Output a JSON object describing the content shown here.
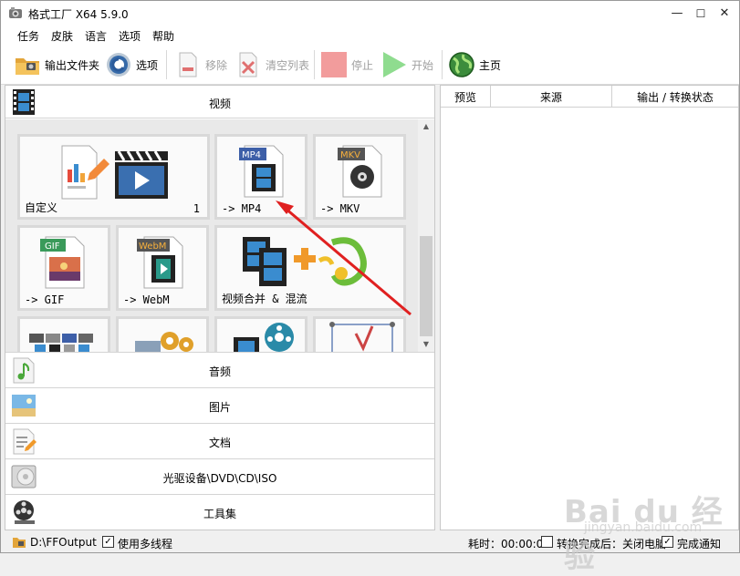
{
  "window": {
    "title": "格式工厂 X64 5.9.0",
    "minimize": "—",
    "maximize": "☐",
    "close": "✕"
  },
  "menu": [
    "任务",
    "皮肤",
    "语言",
    "选项",
    "帮助"
  ],
  "toolbar": {
    "output_folder": "输出文件夹",
    "options": "选项",
    "remove": "移除",
    "clear_list": "清空列表",
    "stop": "停止",
    "start": "开始",
    "home": "主页"
  },
  "left": {
    "video_header": "视频",
    "tiles": [
      {
        "label": "自定义",
        "count": "1"
      },
      {
        "label": "-> MP4",
        "badge": "MP4"
      },
      {
        "label": "-> MKV",
        "badge": "MKV"
      },
      {
        "label": "-> GIF",
        "badge": "GIF"
      },
      {
        "label": "-> WebM",
        "badge": "WebM"
      },
      {
        "label": "视频合并 & 混流"
      }
    ],
    "categories": [
      "音频",
      "图片",
      "文档",
      "光驱设备\\DVD\\CD\\ISO",
      "工具集"
    ]
  },
  "right": {
    "columns": [
      "预览",
      "来源",
      "输出 / 转换状态"
    ]
  },
  "status": {
    "output_path": "D:\\FFOutput",
    "multithread": "使用多线程",
    "elapsed": "耗时：00:00:00",
    "after_done": "转换完成后：关闭电脑",
    "notify": "完成通知"
  },
  "watermark": {
    "main": "Bai du 经验",
    "sub": "jingyan.baidu.com"
  }
}
